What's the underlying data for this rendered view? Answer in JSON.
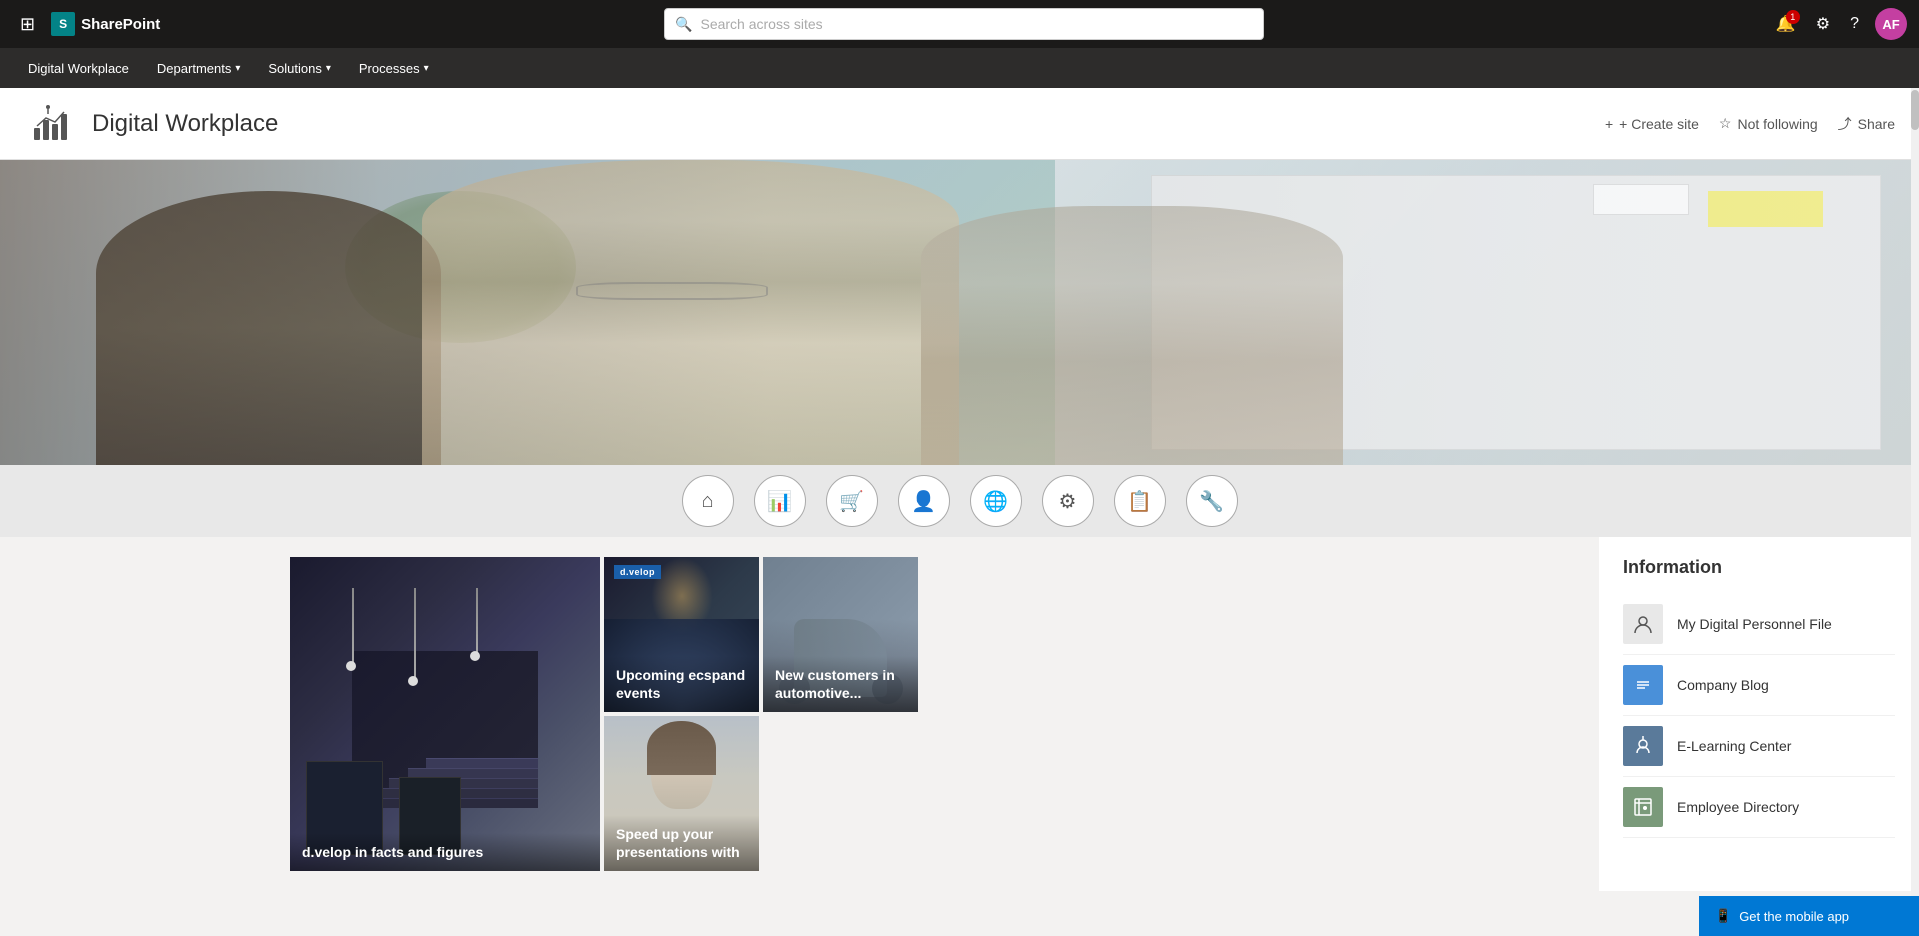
{
  "topbar": {
    "app_name": "SharePoint",
    "waffle_icon": "⊞",
    "search_placeholder": "Search across sites",
    "notification_count": "1",
    "user_initials": "AF"
  },
  "subnav": {
    "items": [
      {
        "label": "Digital Workplace",
        "has_arrow": false
      },
      {
        "label": "Departments",
        "has_arrow": true
      },
      {
        "label": "Solutions",
        "has_arrow": true
      },
      {
        "label": "Processes",
        "has_arrow": true
      }
    ]
  },
  "site_header": {
    "title": "Digital Workplace",
    "actions": {
      "create_site": "+ Create site",
      "not_following": "Not following",
      "share": "Share"
    }
  },
  "icon_bar": {
    "icons": [
      {
        "name": "home-icon",
        "symbol": "⌂"
      },
      {
        "name": "chart-icon",
        "symbol": "📊"
      },
      {
        "name": "basket-icon",
        "symbol": "🛒"
      },
      {
        "name": "person-icon",
        "symbol": "👤"
      },
      {
        "name": "globe-icon",
        "symbol": "🌐"
      },
      {
        "name": "gear-icon",
        "symbol": "⚙"
      },
      {
        "name": "clipboard-icon",
        "symbol": "📋"
      },
      {
        "name": "settings-gear-icon",
        "symbol": "⚙"
      }
    ]
  },
  "news": {
    "cards": [
      {
        "id": "card-stairs",
        "title": "d.velop in facts and figures",
        "tag": "",
        "size": "large"
      },
      {
        "id": "card-events",
        "title": "Upcoming ecspand events",
        "tag": "d.velop",
        "size": "small"
      },
      {
        "id": "card-automotive",
        "title": "New customers in automotive...",
        "tag": "",
        "size": "small"
      },
      {
        "id": "card-presentations",
        "title": "Speed up your presentations with",
        "tag": "",
        "size": "small"
      }
    ]
  },
  "information": {
    "title": "Information",
    "items": [
      {
        "label": "My Digital Personnel File",
        "icon": "person-icon"
      },
      {
        "label": "Company Blog",
        "icon": "blog-icon"
      },
      {
        "label": "E-Learning Center",
        "icon": "elearning-icon"
      },
      {
        "label": "Employee Directory",
        "icon": "directory-icon"
      }
    ]
  },
  "mobile_banner": {
    "label": "Get the mobile app"
  }
}
